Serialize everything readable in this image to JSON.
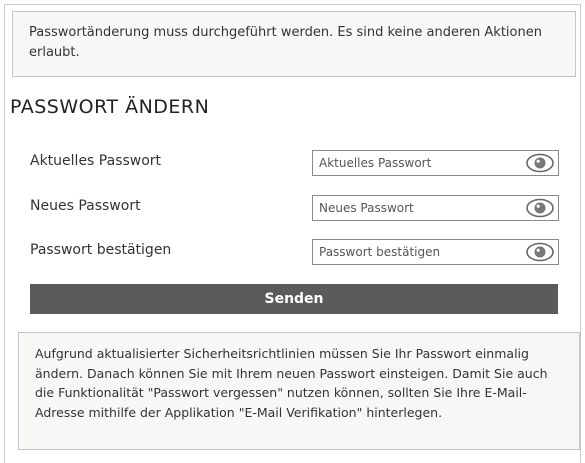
{
  "notice": {
    "text": "Passwortänderung muss durchgeführt werden. Es sind keine anderen Aktionen erlaubt."
  },
  "section": {
    "heading": "PASSWORT ÄNDERN"
  },
  "form": {
    "fields": [
      {
        "label": "Aktuelles Passwort",
        "placeholder": "Aktuelles Passwort",
        "value": ""
      },
      {
        "label": "Neues Passwort",
        "placeholder": "Neues Passwort",
        "value": ""
      },
      {
        "label": "Passwort bestätigen",
        "placeholder": "Passwort bestätigen",
        "value": ""
      }
    ],
    "submit_label": "Senden",
    "toggle_icon": "eye-icon"
  },
  "info": {
    "text": "Aufgrund aktualisierter Sicherheitsrichtlinien müssen Sie Ihr Passwort einmalig ändern. Danach können Sie mit Ihrem neuen Passwort einsteigen. Damit Sie auch die Funktionalität \"Passwort vergessen\" nutzen können, sollten Sie Ihre E-Mail-Adresse mithilfe der Applikation \"E-Mail Verifikation\" hinterlegen."
  },
  "colors": {
    "button_bg": "#5b5b5b",
    "panel_bg": "#f7f8f6",
    "border": "#c6c6c6"
  }
}
